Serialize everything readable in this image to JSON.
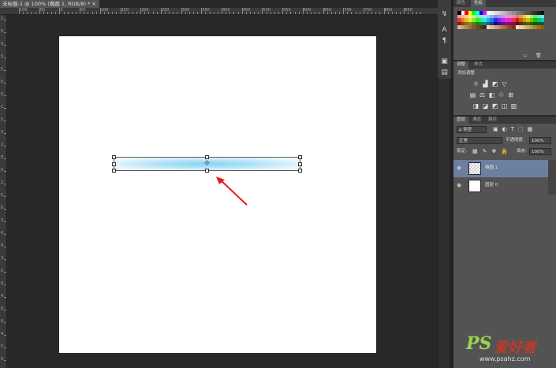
{
  "document": {
    "tab_title": "未标题-1 @ 100% (椭圆 1, RGB/8) *",
    "close_symbol": "×"
  },
  "ruler": {
    "top_labels": [
      "100",
      "50",
      "0",
      "50",
      "100",
      "150",
      "200",
      "250",
      "300",
      "350",
      "400",
      "450",
      "500",
      "550",
      "600",
      "650",
      "700",
      "750",
      "800",
      "850"
    ],
    "left_labels": [
      "1",
      "5",
      "0",
      "5",
      "1",
      "0",
      "0",
      "1",
      "5",
      "0",
      "2",
      "0",
      "0",
      "2",
      "5",
      "0",
      "3",
      "0",
      "0",
      "3",
      "5",
      "0",
      "4",
      "0",
      "0",
      "4",
      "5",
      "0"
    ]
  },
  "colors": {
    "accent_arrow": "#e02020",
    "selected_layer": "#6d7f9f",
    "ellipse_center": "#88d3f3"
  },
  "panels": {
    "swatches": {
      "tabs": [
        "颜色",
        "色板"
      ],
      "rows": [
        [
          "#000000",
          "#ffffff",
          "#ff0000",
          "#ffff00",
          "#00ff00",
          "#00ffff",
          "#0000ff",
          "#ff00ff",
          "#ffffff",
          "#f0f0f0",
          "#e0e0e0",
          "#d0d0d0",
          "#c0c0c0",
          "#b0b0b0",
          "#a0a0a0",
          "#909090",
          "#808080",
          "#707070",
          "#606060",
          "#505050",
          "#404040",
          "#303030",
          "#202020",
          "#101010"
        ],
        [
          "#f79a8a",
          "#f7b48a",
          "#f7d08a",
          "#f7f08a",
          "#c8f08a",
          "#8af08a",
          "#8af0c8",
          "#8af0f0",
          "#8ad0f7",
          "#8ab0f7",
          "#8a8af7",
          "#b08af7",
          "#d08af7",
          "#f08af0",
          "#f08ac8",
          "#f08aa0",
          "#f56b5a",
          "#f5965a",
          "#f5c05a",
          "#f5f05a",
          "#a8f05a",
          "#5af05a",
          "#5af0a8",
          "#5af0f0"
        ],
        [
          "#ea3b2a",
          "#ea7a2a",
          "#eab52a",
          "#eaea2a",
          "#8aea2a",
          "#2aea2a",
          "#2aea8a",
          "#2aeaea",
          "#2aaaea",
          "#2a7aea",
          "#2a2aea",
          "#7a2aea",
          "#b52aea",
          "#ea2aea",
          "#ea2ab5",
          "#ea2a7a",
          "#c22010",
          "#c26010",
          "#c29a10",
          "#c2c210",
          "#6ac210",
          "#10c210",
          "#10c26a",
          "#10c2c2"
        ],
        [
          "#8a1a0a",
          "#8a4a0a",
          "#8a6e0a",
          "#8a8a0a",
          "#4a8a0a",
          "#0a8a0a",
          "#0a8a4a",
          "#0a8a8a",
          "#0a6e8a",
          "#0a4a8a",
          "#0a0a8a",
          "#4a0a8a",
          "#6e0a8a",
          "#8a0a8a",
          "#8a0a6e",
          "#8a0a4a",
          "#5a1206",
          "#5a3006",
          "#5a4806",
          "#5a5a06",
          "#305a06",
          "#065a06",
          "#065a30",
          "#065a5a"
        ],
        [
          "#d4b896",
          "#c4a07a",
          "#b08860",
          "#9c7048",
          "#885a34",
          "#744624",
          "#603418",
          "#4c2410",
          "#f0d8b8",
          "#e0c098",
          "#d0a878",
          "#c09058",
          "#b07840",
          "#a06028",
          "#904818",
          "#803008",
          "#f5e6c8",
          "#e8d2a8",
          "#dbbe88",
          "#ceaa68",
          "#c19648",
          "#b48228",
          "#a76e08",
          "#9a5a00"
        ]
      ]
    },
    "adjustments": {
      "tabs": [
        "调整",
        "样式"
      ],
      "title": "添加调整",
      "rows": [
        [
          "☼",
          "▟",
          "◩",
          "▽"
        ],
        [
          "▤",
          "⚖",
          "◧",
          "♲",
          "⊞"
        ],
        [
          "◨",
          "◪",
          "◩",
          "◫",
          "▥"
        ]
      ]
    },
    "layers": {
      "tabs": [
        "图层",
        "通道",
        "路径"
      ],
      "filter_label": "ρ 类型",
      "blend_mode": "正常",
      "opacity_label": "不透明度:",
      "opacity_value": "100%",
      "lock_label": "锁定:",
      "fill_label": "填充:",
      "fill_value": "100%",
      "items": [
        {
          "name": "椭圆 1",
          "selected": true,
          "visible": true
        },
        {
          "name": "图层 0",
          "selected": false,
          "visible": true
        }
      ]
    }
  },
  "watermark": {
    "logo": "PS",
    "brand": "爱好者",
    "url": "www.psahz.com"
  }
}
